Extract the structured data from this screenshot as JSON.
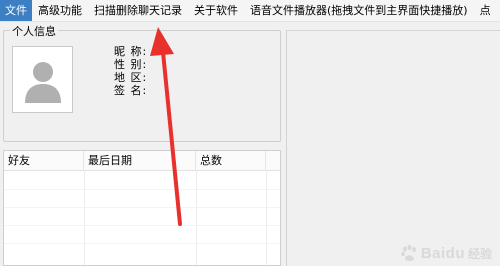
{
  "menu": {
    "items": [
      {
        "label": "文件"
      },
      {
        "label": "高级功能"
      },
      {
        "label": "扫描删除聊天记录"
      },
      {
        "label": "关于软件"
      },
      {
        "label": "语音文件播放器(拖拽文件到主界面快捷播放)"
      },
      {
        "label": "点"
      }
    ]
  },
  "profile": {
    "group_title": "个人信息",
    "nickname_label": "昵  称:",
    "gender_label": "性  别:",
    "region_label": "地  区:",
    "signature_label": "签  名:",
    "avatar_icon": "user-silhouette-icon"
  },
  "friend_table": {
    "columns": [
      "好友",
      "最后日期",
      "总数"
    ],
    "rows": []
  },
  "watermark": {
    "brand": "Baidu",
    "suffix": "经验"
  },
  "colors": {
    "menu_active": "#3d7fc4",
    "arrow": "#e8312c"
  }
}
